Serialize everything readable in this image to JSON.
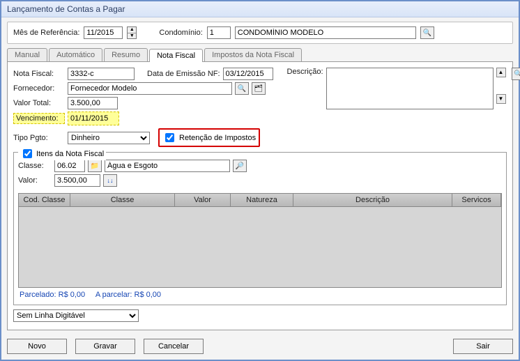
{
  "window": {
    "title": "Lançamento de Contas a Pagar"
  },
  "filter": {
    "mes_ref_label": "Mês de Referência:",
    "mes_ref_value": "11/2015",
    "condominio_label": "Condomínio:",
    "condominio_code": "1",
    "condominio_name": "CONDOMÍNIO MODELO"
  },
  "tabs": {
    "t0": "Manual",
    "t1": "Automático",
    "t2": "Resumo",
    "t3": "Nota Fiscal",
    "t4": "Impostos da Nota Fiscal"
  },
  "nf": {
    "nota_label": "Nota Fiscal:",
    "nota_value": "3332-c",
    "data_label": "Data de Emissão NF:",
    "data_value": "03/12/2015",
    "fornecedor_label": "Fornecedor:",
    "fornecedor_value": "Fornecedor Modelo",
    "valor_label": "Valor Total:",
    "valor_value": "3.500,00",
    "venc_label": "Vencimento:",
    "venc_value": "01/11/2015",
    "tipo_label": "Tipo Pgto:",
    "tipo_value": "Dinheiro",
    "retencao_label": "Retenção de Impostos",
    "descricao_label": "Descrição:",
    "descricao_value": ""
  },
  "itens": {
    "legend": "Itens da Nota Fiscal",
    "classe_label": "Classe:",
    "classe_code": "06.02",
    "classe_name": "Água e Esgoto",
    "valor_label": "Valor:",
    "valor_value": "3.500,00",
    "col0": "Cod. Classe",
    "col1": "Classe",
    "col2": "Valor",
    "col3": "Natureza",
    "col4": "Descrição",
    "col5": "Servicos"
  },
  "status": {
    "parcelado": "Parcelado: R$ 0,00",
    "aparcelar": "A parcelar: R$ 0,00"
  },
  "linha": {
    "value": "Sem Linha Digitável"
  },
  "buttons": {
    "novo": "Novo",
    "gravar": "Gravar",
    "cancelar": "Cancelar",
    "sair": "Sair"
  }
}
